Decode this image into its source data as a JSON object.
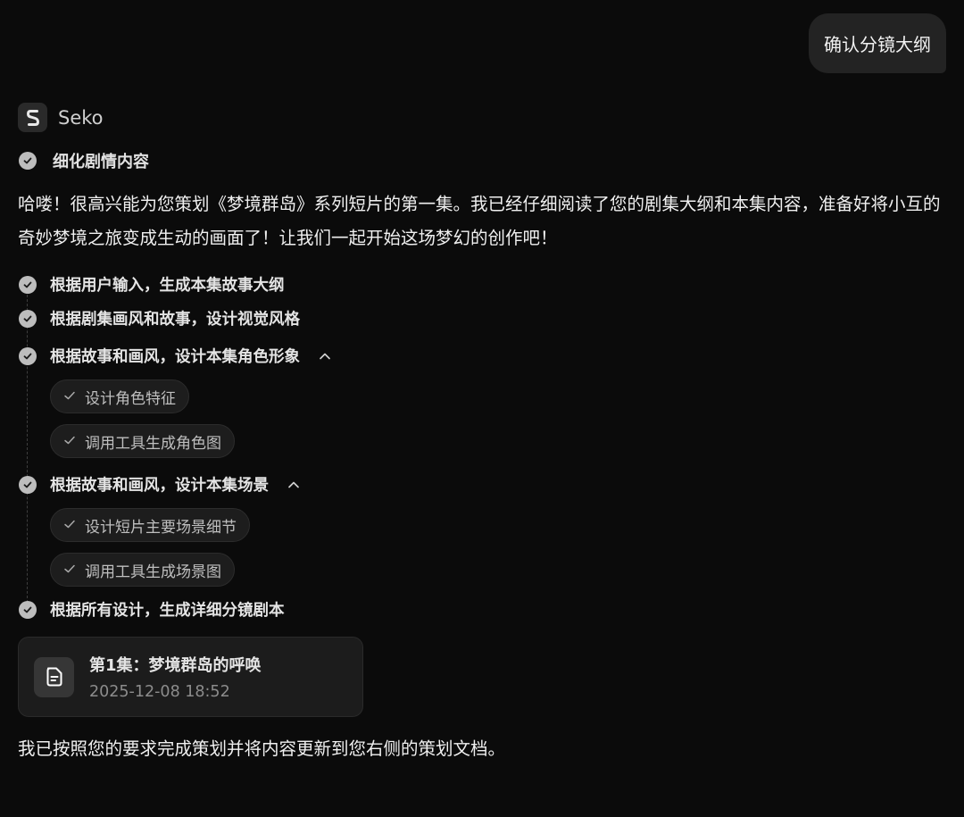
{
  "user_message": "确认分镜大纲",
  "assistant": {
    "name": "Seko"
  },
  "top_step": {
    "label": "细化剧情内容"
  },
  "intro_text": "哈喽！很高兴能为您策划《梦境群岛》系列短片的第一集。我已经仔细阅读了您的剧集大纲和本集内容，准备好将小互的奇妙梦境之旅变成生动的画面了！让我们一起开始这场梦幻的创作吧！",
  "steps": [
    {
      "label": "根据用户输入，生成本集故事大纲"
    },
    {
      "label": "根据剧集画风和故事，设计视觉风格"
    },
    {
      "label": "根据故事和画风，设计本集角色形象",
      "expanded": true,
      "substeps": [
        {
          "label": "设计角色特征"
        },
        {
          "label": "调用工具生成角色图"
        }
      ]
    },
    {
      "label": "根据故事和画风，设计本集场景",
      "expanded": true,
      "substeps": [
        {
          "label": "设计短片主要场景细节"
        },
        {
          "label": "调用工具生成场景图"
        }
      ]
    },
    {
      "label": "根据所有设计，生成详细分镜剧本"
    }
  ],
  "document": {
    "title": "第1集：梦境群岛的呼唤",
    "date": "2025-12-08 18:52"
  },
  "closing_text": "我已按照您的要求完成策划并将内容更新到您右侧的策划文档。",
  "colors": {
    "background": "#0b0b0b",
    "bubble": "#232323",
    "check": "#bdbdbd"
  }
}
